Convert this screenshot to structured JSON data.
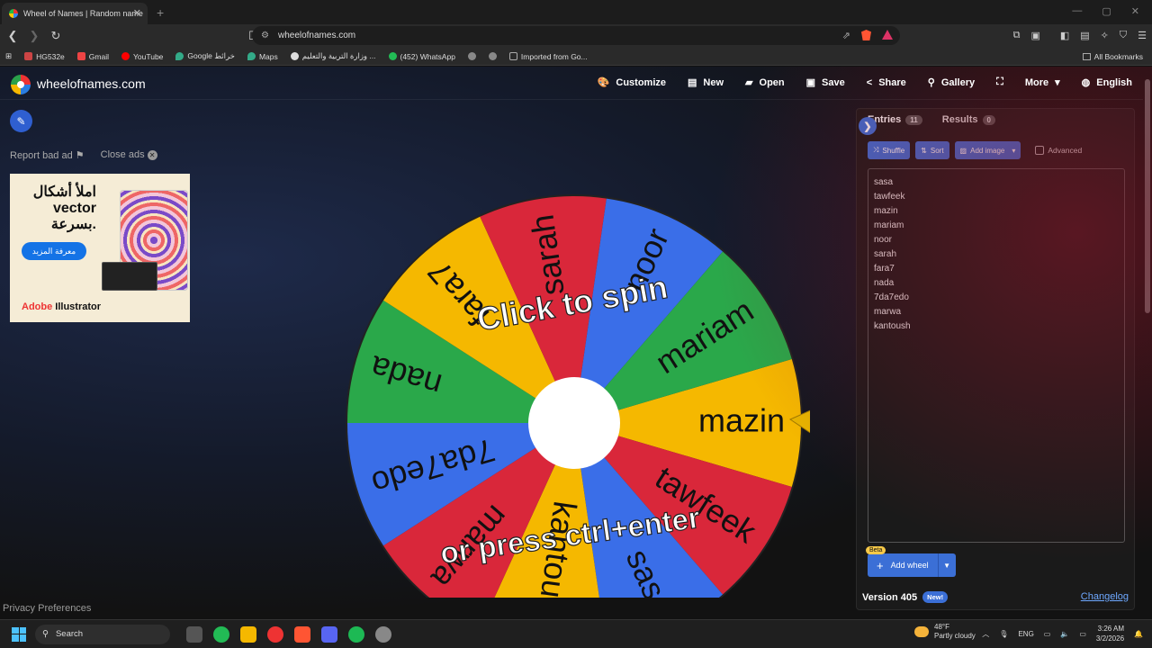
{
  "browser": {
    "tab_title": "Wheel of Names | Random name",
    "tab_close": "✕",
    "new_tab": "+",
    "window_controls": [
      "—",
      "▢",
      "✕"
    ],
    "url": "wheelofnames.com",
    "bookmarks": [
      {
        "label": "HG532e",
        "color": "#c44"
      },
      {
        "label": "Gmail",
        "color": "#e44"
      },
      {
        "label": "YouTube",
        "color": "#f00"
      },
      {
        "label": "Google خرائط",
        "color": "#3a8"
      },
      {
        "label": "Maps",
        "color": "#3a8"
      },
      {
        "label": "وزارة التربية والتعليم ...",
        "color": "#ccc"
      },
      {
        "label": "(452) WhatsApp",
        "color": "#2b5"
      },
      {
        "label": "",
        "color": "#888"
      },
      {
        "label": "",
        "color": "#888"
      },
      {
        "label": "Imported from Go...",
        "color": "#666"
      }
    ],
    "all_bookmarks": "All Bookmarks"
  },
  "header": {
    "site_name": "wheelofnames.com",
    "menu": [
      {
        "label": "Customize",
        "icon": "🎨"
      },
      {
        "label": "New",
        "icon": "▤"
      },
      {
        "label": "Open",
        "icon": "▰"
      },
      {
        "label": "Save",
        "icon": "▣"
      },
      {
        "label": "Share",
        "icon": "<"
      },
      {
        "label": "Gallery",
        "icon": "⚲"
      },
      {
        "label": "",
        "icon": "⛶"
      },
      {
        "label": "More",
        "icon": "▾"
      },
      {
        "label": "English",
        "icon": "◍"
      }
    ]
  },
  "left": {
    "report": "Report bad ad",
    "close_ads": "Close ads",
    "ad_headline": "املأ أشكال vector بسرعة.",
    "ad_cta": "معرفة المزيد",
    "ad_brand_adobe": "Adobe",
    "ad_brand_product": " Illustrator",
    "privacy": "Privacy Preferences"
  },
  "wheel": {
    "center_text_top": "Click to spin",
    "center_text_bottom": "or press ctrl+enter",
    "colors": {
      "yellow": "#f5b800",
      "red": "#d9273a",
      "blue": "#3a6ee8",
      "green": "#2aa84a"
    },
    "segments": [
      {
        "name": "mazin",
        "color": "#f5b800"
      },
      {
        "name": "tawfeek",
        "color": "#d9273a"
      },
      {
        "name": "sasa",
        "color": "#3a6ee8"
      },
      {
        "name": "kantoush",
        "color": "#f5b800"
      },
      {
        "name": "marwa",
        "color": "#d9273a"
      },
      {
        "name": "7da7edo",
        "color": "#3a6ee8"
      },
      {
        "name": "nada",
        "color": "#2aa84a"
      },
      {
        "name": "fara7",
        "color": "#f5b800"
      },
      {
        "name": "sarah",
        "color": "#d9273a"
      },
      {
        "name": "noor",
        "color": "#3a6ee8"
      },
      {
        "name": "mariam",
        "color": "#2aa84a"
      }
    ]
  },
  "panel": {
    "tab_entries": "Entries",
    "entries_count": "11",
    "tab_results": "Results",
    "results_count": "0",
    "shuffle": "Shuffle",
    "sort": "Sort",
    "add_image": "Add image",
    "advanced": "Advanced",
    "entries": [
      "sasa",
      "tawfeek",
      "mazin",
      "mariam",
      "noor",
      "sarah",
      "fara7",
      "nada",
      "7da7edo",
      "marwa",
      "kantoush"
    ],
    "beta": "Beta",
    "add_wheel": "Add wheel",
    "version": "Version 405",
    "new_badge": "New!",
    "changelog": "Changelog"
  },
  "taskbar": {
    "search": "Search",
    "weather_temp": "48°F",
    "weather_desc": "Partly cloudy",
    "lang": "ENG",
    "time": "3:26 AM",
    "date": "3/2/2026",
    "apps": [
      "#555",
      "#2b5",
      "#f5b800",
      "#e33",
      "#f53",
      "#5865f2",
      "#1db954",
      "#888"
    ]
  }
}
